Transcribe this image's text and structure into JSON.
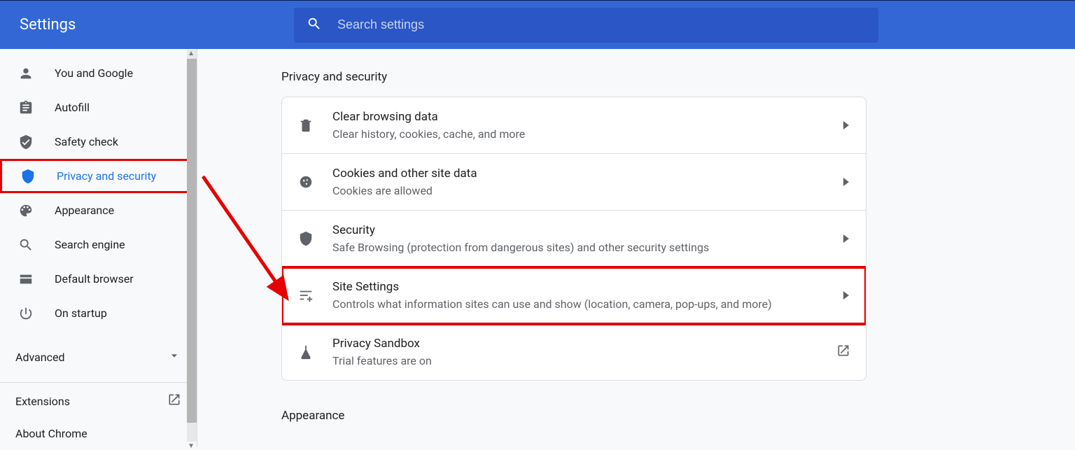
{
  "header": {
    "title": "Settings"
  },
  "search": {
    "placeholder": "Search settings"
  },
  "sidebar": {
    "items": [
      {
        "label": "You and Google"
      },
      {
        "label": "Autofill"
      },
      {
        "label": "Safety check"
      },
      {
        "label": "Privacy and security"
      },
      {
        "label": "Appearance"
      },
      {
        "label": "Search engine"
      },
      {
        "label": "Default browser"
      },
      {
        "label": "On startup"
      }
    ],
    "advanced": "Advanced",
    "extensions": "Extensions",
    "about": "About Chrome"
  },
  "main": {
    "section1_title": "Privacy and security",
    "rows": [
      {
        "title": "Clear browsing data",
        "sub": "Clear history, cookies, cache, and more"
      },
      {
        "title": "Cookies and other site data",
        "sub": "Cookies are allowed"
      },
      {
        "title": "Security",
        "sub": "Safe Browsing (protection from dangerous sites) and other security settings"
      },
      {
        "title": "Site Settings",
        "sub": "Controls what information sites can use and show (location, camera, pop-ups, and more)"
      },
      {
        "title": "Privacy Sandbox",
        "sub": "Trial features are on"
      }
    ],
    "section2_title": "Appearance"
  }
}
